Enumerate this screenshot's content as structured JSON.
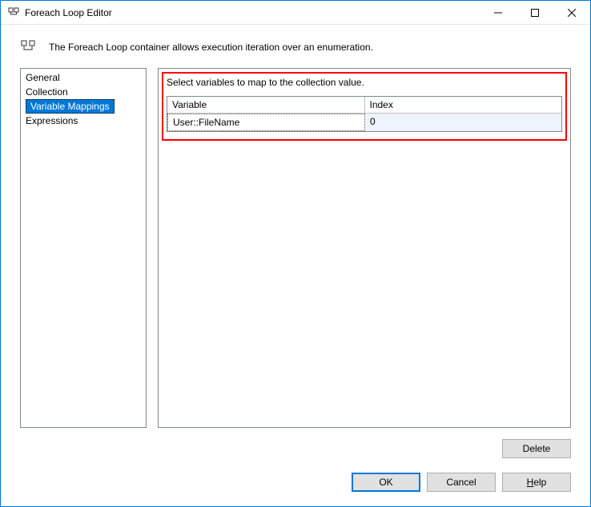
{
  "window": {
    "title": "Foreach Loop Editor"
  },
  "description": "The Foreach Loop container allows execution iteration over an enumeration.",
  "nav": {
    "items": [
      {
        "label": "General"
      },
      {
        "label": "Collection"
      },
      {
        "label": "Variable Mappings"
      },
      {
        "label": "Expressions"
      }
    ],
    "selectedIndex": 2
  },
  "main": {
    "instruction": "Select variables to map to the collection value.",
    "grid": {
      "headers": [
        "Variable",
        "Index"
      ],
      "rows": [
        {
          "variable": "User::FileName",
          "index": "0"
        }
      ]
    }
  },
  "buttons": {
    "delete": "Delete",
    "ok": "OK",
    "cancel": "Cancel",
    "help_prefix": "H",
    "help_rest": "elp"
  }
}
